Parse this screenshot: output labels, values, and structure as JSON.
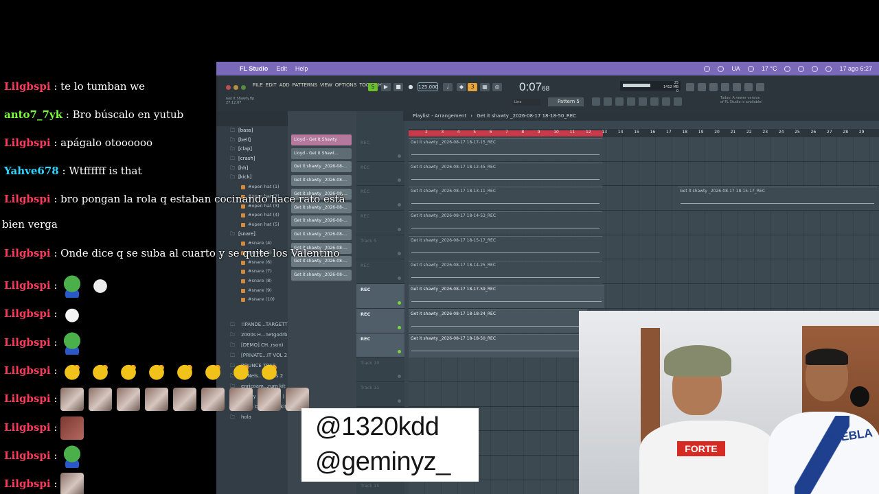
{
  "menubar": {
    "app_name": "FL Studio",
    "items": [
      "Edit",
      "Help"
    ],
    "status_ua": "UA",
    "status_weather": "17 °C",
    "datetime": "17 ago 6:27"
  },
  "toolbar": {
    "menus": [
      "FILE",
      "EDIT",
      "ADD",
      "PATTERNS",
      "VIEW",
      "OPTIONS",
      "TOOLS",
      "HELP"
    ],
    "song_label": "Get It Shawty.flp",
    "song_time": "27:12:07",
    "tempo": "125.000",
    "time_display": "0:07",
    "time_frac": "68",
    "pattern": "Pattern 5",
    "line_mode": "Line",
    "cpu": "25",
    "memory": "1412 MB",
    "memory_sub": "0",
    "news_line1": "Today: A newer version",
    "news_line2": "of FL Studio is available!"
  },
  "browser": {
    "items": [
      {
        "label": "[bass]",
        "type": "folder"
      },
      {
        "label": "[bell]",
        "type": "folder"
      },
      {
        "label": "[clap]",
        "type": "folder"
      },
      {
        "label": "[crash]",
        "type": "folder"
      },
      {
        "label": "[hh]",
        "type": "folder"
      },
      {
        "label": "[kick]",
        "type": "folder"
      },
      {
        "label": "#open hat (1)",
        "type": "file"
      },
      {
        "label": "#open hat (2)",
        "type": "file"
      },
      {
        "label": "#open hat (3)",
        "type": "file"
      },
      {
        "label": "#open hat (4)",
        "type": "file"
      },
      {
        "label": "#open hat (5)",
        "type": "file"
      },
      {
        "label": "[snare]",
        "type": "folder"
      },
      {
        "label": "#snare (4)",
        "type": "file"
      },
      {
        "label": "#snare (5)",
        "type": "file"
      },
      {
        "label": "#snare (6)",
        "type": "file"
      },
      {
        "label": "#snare (7)",
        "type": "file"
      },
      {
        "label": "#snare (8)",
        "type": "file"
      },
      {
        "label": "#snare (9)",
        "type": "file"
      },
      {
        "label": "#snare (10)",
        "type": "file"
      }
    ],
    "packs": [
      "!!PANDE...TARGETT",
      "2000s H...netgodrb",
      "[DEMO] CH..rson)",
      "[PRIVATE...IT VOL 2",
      "BOUNCE TRAP",
      "Dj Nels...Drums 2",
      "enricoam...rum kit",
      "Heazy - No..k Kit )",
      "Hella O...s Drumkit",
      "hola"
    ]
  },
  "channels": [
    {
      "label": "Lloyd - Get It Shawty",
      "style": "pink"
    },
    {
      "label": "Lloyd - Get It Shawt...",
      "style": "plain"
    },
    {
      "label": "Get it shawty _2026-08-...",
      "style": "default"
    },
    {
      "label": "Get it shawty _2026-08-...",
      "style": "default"
    },
    {
      "label": "Get it shawty _2026-08-...",
      "style": "default"
    },
    {
      "label": "Get it shawty _2026-08-...",
      "style": "default"
    },
    {
      "label": "Get it shawty _2026-08-...",
      "style": "default"
    },
    {
      "label": "Get it shawty _2026-08-...",
      "style": "default"
    },
    {
      "label": "Get it shawty _2026-08-...",
      "style": "default"
    },
    {
      "label": "Get it shawty _2026-08-...",
      "style": "default"
    },
    {
      "label": "Get it shawty _2026-08-...",
      "style": "default"
    }
  ],
  "playlist": {
    "title": "Playlist - Arrangement",
    "breadcrumb": "Get it shawty _2026-08-17 18-18-50_REC",
    "ruler": [
      "2",
      "3",
      "4",
      "5",
      "6",
      "7",
      "8",
      "9",
      "10",
      "11",
      "12",
      "13",
      "14",
      "15",
      "16",
      "17",
      "18",
      "19",
      "20",
      "21",
      "22",
      "23",
      "24",
      "25",
      "26",
      "27",
      "28",
      "29"
    ],
    "tracks": [
      {
        "label": "REC",
        "active": false
      },
      {
        "label": "REC",
        "active": false
      },
      {
        "label": "REC",
        "active": false
      },
      {
        "label": "REC",
        "active": false
      },
      {
        "label": "Track 5",
        "active": false
      },
      {
        "label": "REC",
        "active": false
      },
      {
        "label": "REC",
        "active": true
      },
      {
        "label": "REC",
        "active": true
      },
      {
        "label": "REC",
        "active": true
      },
      {
        "label": "Track 10",
        "active": false
      },
      {
        "label": "Track 11",
        "active": false
      },
      {
        "label": "",
        "active": false
      },
      {
        "label": "",
        "active": false
      },
      {
        "label": "",
        "active": false
      },
      {
        "label": "Track 15",
        "active": false
      }
    ],
    "clips": [
      "Get it shawty _2026-08-17 18-17-15_REC",
      "Get it shawty _2026-08-17 18-12-45_REC",
      "Get it shawty _2026-08-17 18-13-11_REC",
      "Get it shawty _2026-08-17 18-15-17_REC",
      "Get it shawty _2026-08-17 18-14-53_REC",
      "Get it shawty _2026-08-17 18-15-17_REC",
      "Get it shawty _2026-08-17 18-14-25_REC",
      "Get it shawty _2026-08-17 18-17-59_REC",
      "Get it shawty _2026-08-17 18-18-24_REC",
      "Get it shawty _2026-08-17 18-18-50_REC"
    ]
  },
  "chat": [
    {
      "user": "Lilgbspi",
      "color": "#ff3b5c",
      "text": "te lo tumban we"
    },
    {
      "user": "anto7_7yk",
      "color": "#7cff3a",
      "text": "Bro búscalo en yutub"
    },
    {
      "user": "Lilgbspi",
      "color": "#ff3b5c",
      "text": "apágalo otoooooo"
    },
    {
      "user": "Yahve678",
      "color": "#31d6ff",
      "text": "Wtffffff is that"
    },
    {
      "user": "Lilgbspi",
      "color": "#ff3b5c",
      "text": "bro pongan la rola q estaban cocinando hace rato está"
    },
    {
      "user": "",
      "color": "#ffffff",
      "text": "bien verga"
    },
    {
      "user": "Lilgbspi",
      "color": "#ff3b5c",
      "text": "Onde dice q se suba al cuarto y se quite los Valentino"
    },
    {
      "user": "Lilgbspi",
      "color": "#ff3b5c",
      "text": ""
    },
    {
      "user": "Lilgbspi",
      "color": "#ff3b5c",
      "text": ""
    },
    {
      "user": "Lilgbspi",
      "color": "#ff3b5c",
      "text": ""
    },
    {
      "user": "Lilgbspi",
      "color": "#ff3b5c",
      "text": ""
    },
    {
      "user": "Lilgbspi",
      "color": "#ff3b5c",
      "text": ""
    },
    {
      "user": "Lilgbspi",
      "color": "#ff3b5c",
      "text": ""
    },
    {
      "user": "Lilgbspi",
      "color": "#ff3b5c",
      "text": ""
    },
    {
      "user": "Lilgbspi",
      "color": "#ff3b5c",
      "text": ""
    }
  ],
  "webcam": {
    "shirt1": "FORTE",
    "shirt2": "PUEBLA"
  },
  "handles": [
    "@1320kdd",
    "@geminyz_"
  ],
  "colors": {
    "macbar": "#7a68b8",
    "rec_ruler": "#c73a4a",
    "active_led": "#7ad63a"
  }
}
